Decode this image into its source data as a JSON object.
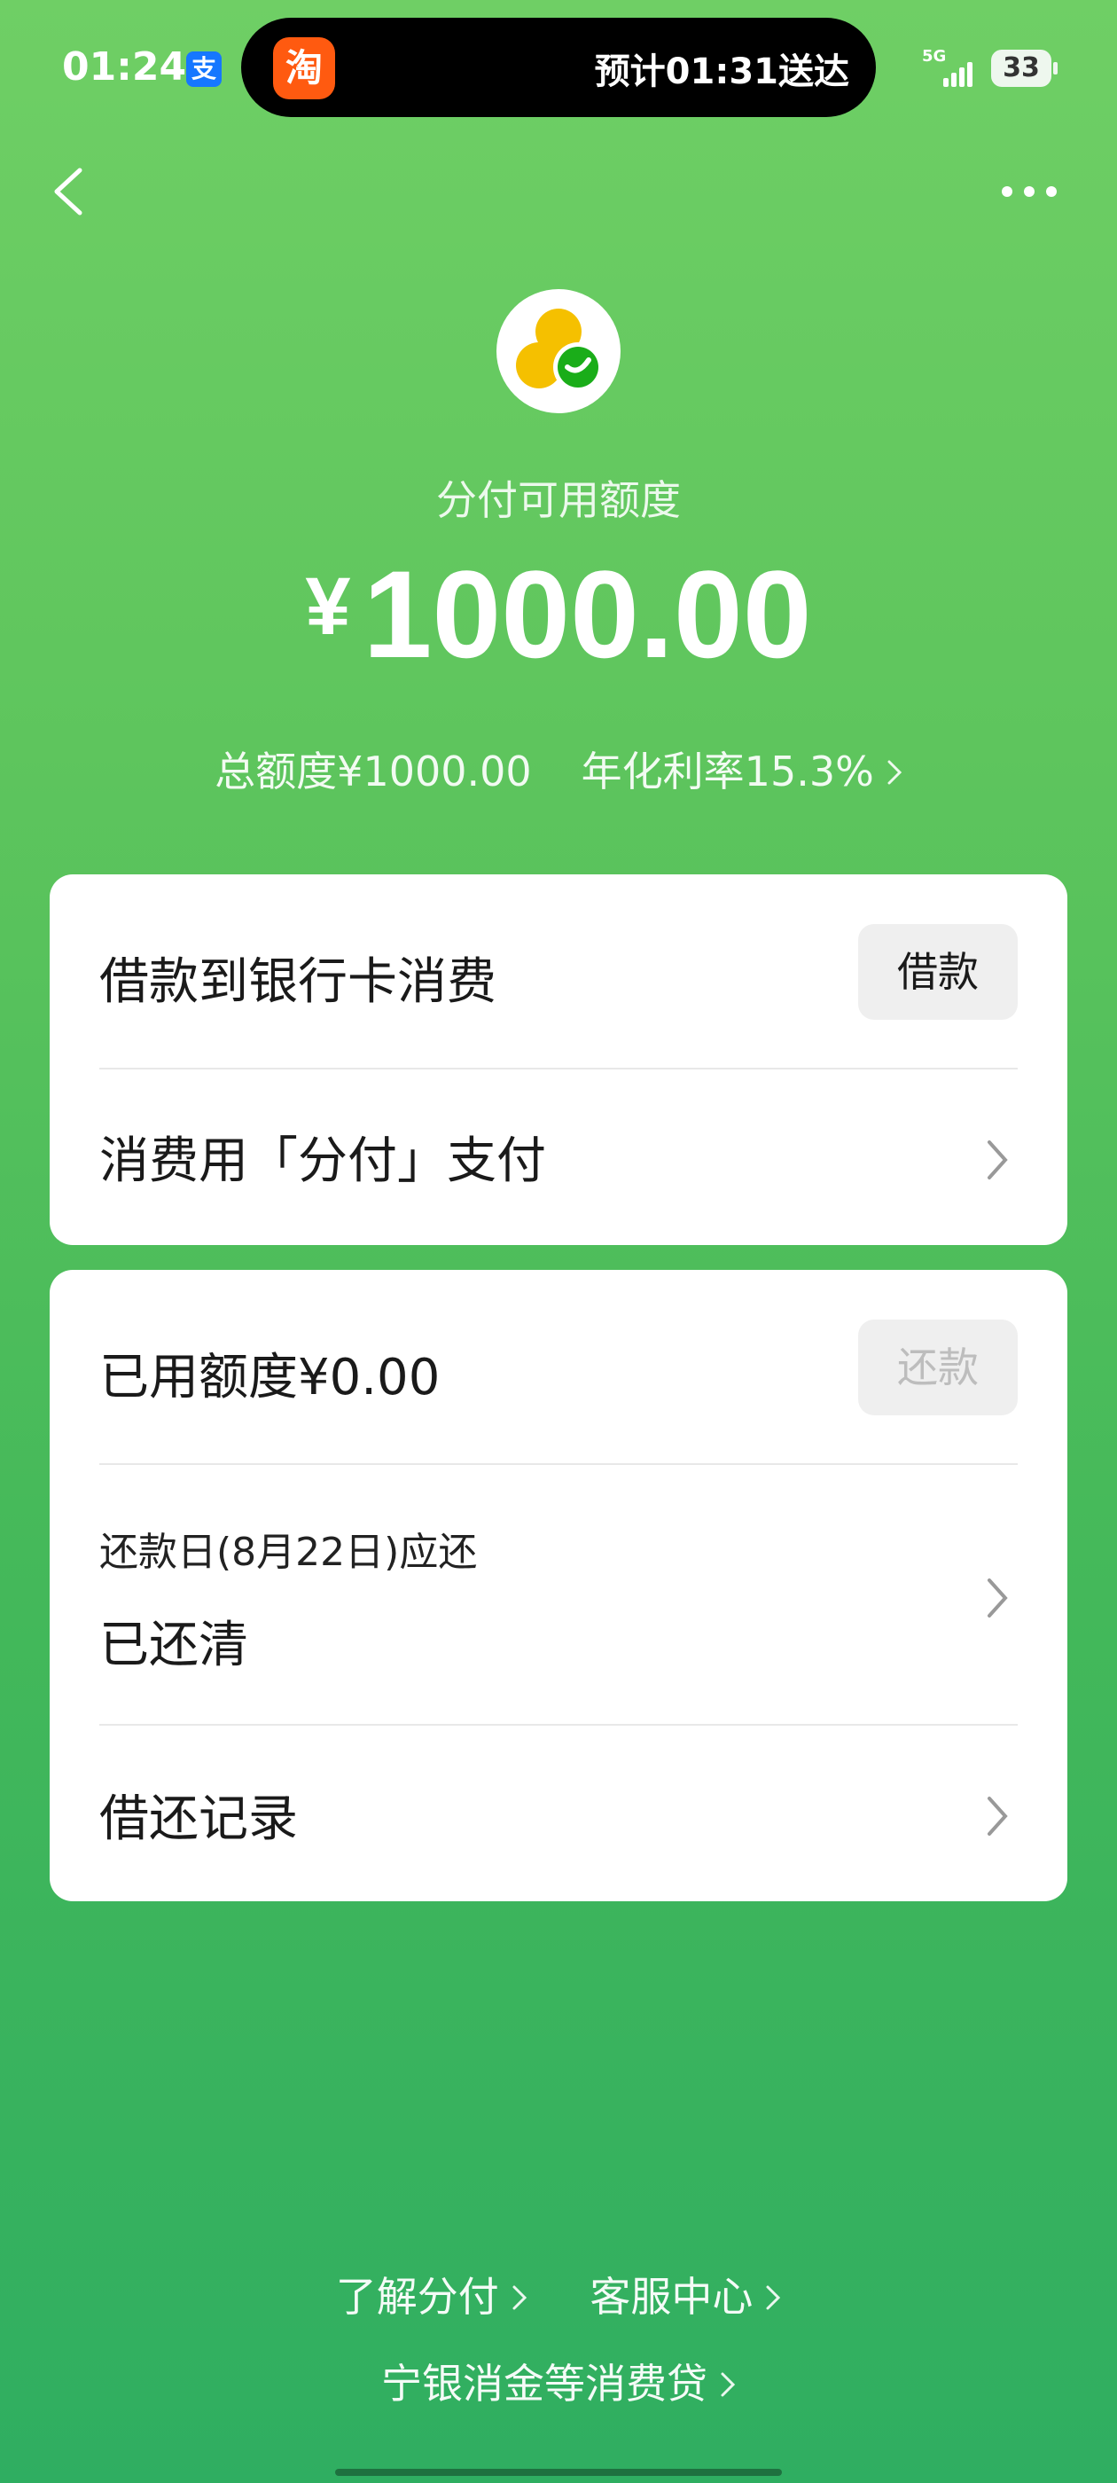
{
  "status_bar": {
    "time": "01:24",
    "alipay_glyph": "支",
    "island_app_glyph": "淘",
    "island_text": "预计01:31送达",
    "network": "5G",
    "battery": "33"
  },
  "nav": {
    "back_icon": "back-chevron-icon",
    "more_icon": "more-dots-icon"
  },
  "header": {
    "subtitle": "分付可用额度",
    "currency": "¥",
    "available_amount": "1000.00",
    "total_limit": "总额度¥1000.00",
    "annual_rate": "年化利率15.3%"
  },
  "card1": {
    "loan_title": "借款到银行卡消费",
    "loan_button": "借款",
    "pay_title": "消费用「分付」支付"
  },
  "card2": {
    "used_title": "已用额度¥0.00",
    "repay_button": "还款",
    "due_label": "还款日(8月22日)应还",
    "due_status": "已还清",
    "records_title": "借还记录"
  },
  "footer": {
    "learn": "了解分付",
    "service": "客服中心",
    "loans": "宁银消金等消费贷"
  },
  "colors": {
    "gradient_top": "#6fcf65",
    "gradient_bottom": "#2fae61",
    "logo_yellow": "#f5c000",
    "logo_green": "#1aad19"
  }
}
